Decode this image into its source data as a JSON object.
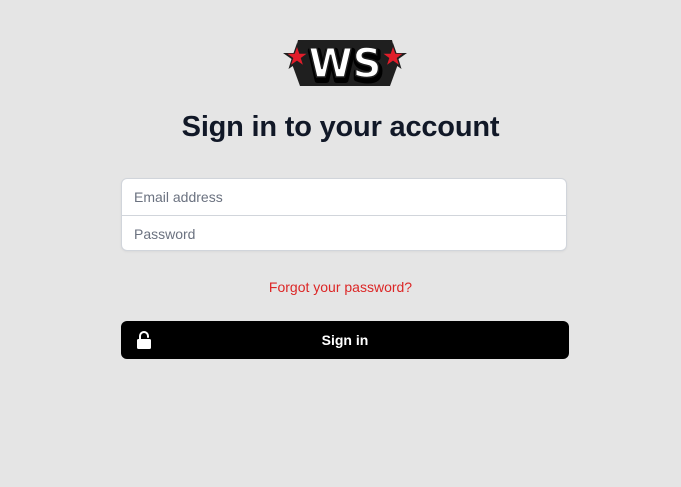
{
  "logo": {
    "text": "WS",
    "icon": "ws-logo-with-red-stars"
  },
  "title": "Sign in to your account",
  "form": {
    "email_placeholder": "Email address",
    "password_placeholder": "Password"
  },
  "forgot_link": "Forgot your password?",
  "signin_button": {
    "label": "Sign in",
    "icon": "lock-icon"
  },
  "colors": {
    "background": "#e5e5e5",
    "link": "#dc2626",
    "button": "#000000",
    "star": "#e11d2a"
  }
}
